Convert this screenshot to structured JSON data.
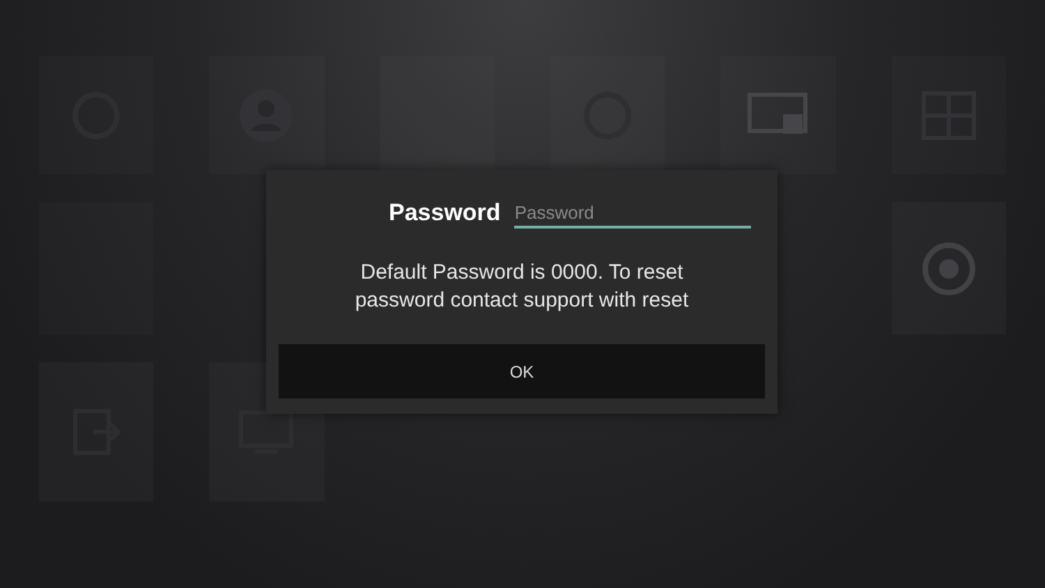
{
  "dialog": {
    "label": "Password",
    "field": {
      "placeholder": "Password"
    },
    "message": "Default Password is 0000. To reset password contact support with reset",
    "buttons": [
      "OK"
    ]
  }
}
